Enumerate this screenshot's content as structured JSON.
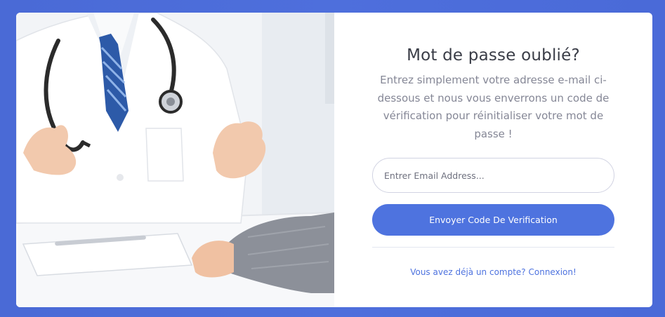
{
  "illustration": {
    "description_icon": "doctor-illustration-icon"
  },
  "form": {
    "title": "Mot de passe oublié?",
    "subtitle": "Entrez simplement votre adresse e-mail ci-dessous et nous vous enverrons un code de vérification pour réinitialiser votre mot de passe !",
    "email_placeholder": "Entrer Email Address...",
    "email_value": "",
    "submit_label": "Envoyer Code De Verification",
    "login_link": "Vous avez déjà un compte? Connexion!"
  },
  "colors": {
    "background": "#4e73df",
    "primary_button": "#4e73df",
    "link": "#4e73df",
    "title_text": "#3a3d47",
    "subtitle_text": "#858796"
  }
}
